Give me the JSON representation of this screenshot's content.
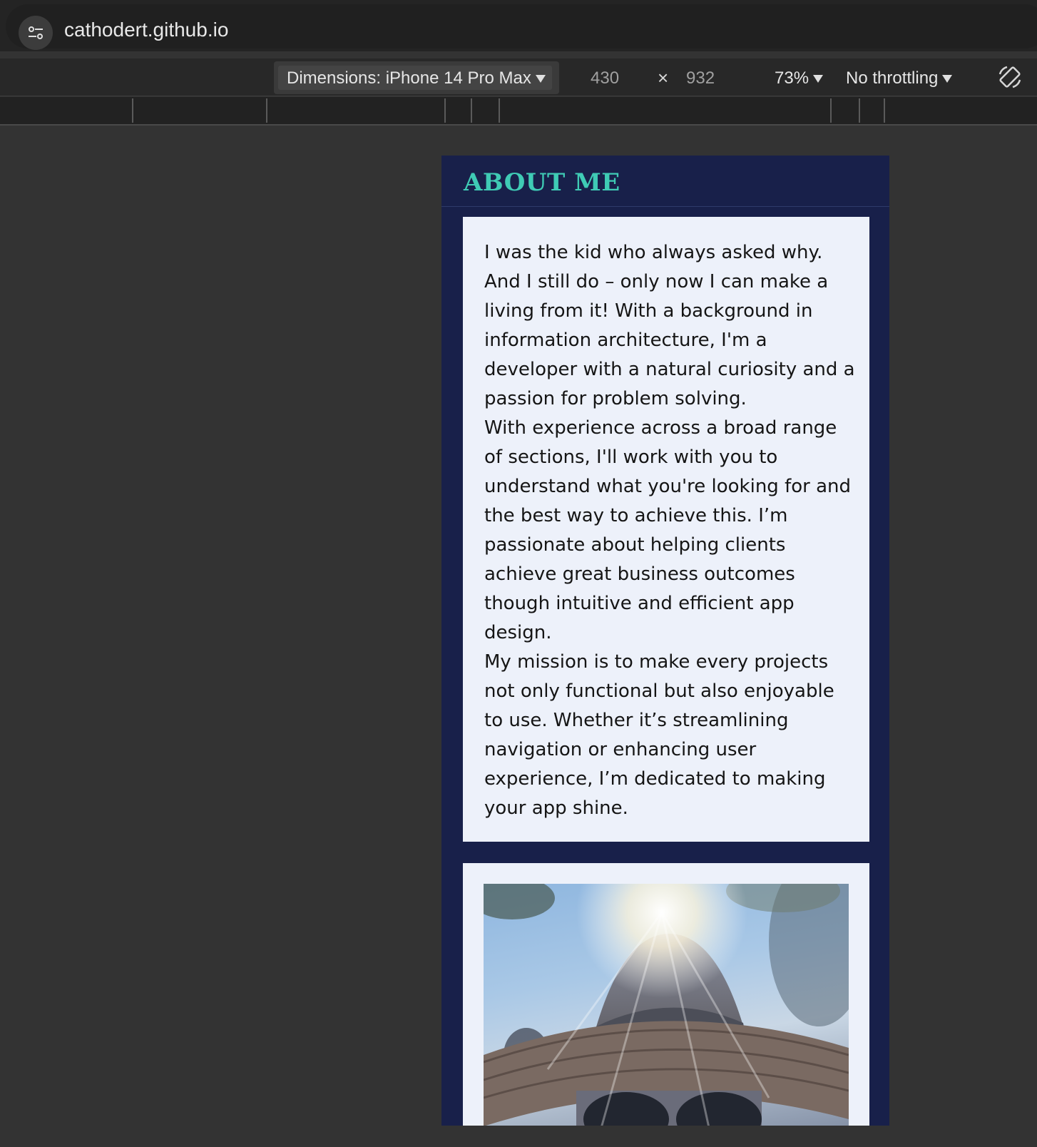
{
  "browser": {
    "url": "cathodert.github.io",
    "site_info_icon": "tune-icon"
  },
  "device_toolbar": {
    "dimensions_label": "Dimensions: iPhone 14 Pro Max",
    "width": "430",
    "separator": "×",
    "height": "932",
    "zoom": "73%",
    "throttling": "No throttling",
    "rotate_icon": "rotate-icon"
  },
  "page": {
    "section_title": "ABOUT ME",
    "paragraphs": [
      "I was the kid who always asked why. And I still do – only now I can make a living from it! With a background in information architecture, I'm a developer with a natural curiosity and a passion for problem solving.",
      "With experience across a broad range of sections, I'll work with you to understand what you're looking for and the best way to achieve this. I’m passionate about helping clients achieve great business outcomes though intuitive and efficient app design.",
      "My mission is to make every projects not only functional but also enjoyable to use. Whether it’s streamlining navigation or enhancing user experience, I’m dedicated to making your app shine."
    ]
  },
  "colors": {
    "page_bg": "#18204a",
    "accent": "#3fcbb5",
    "card_bg": "#edf1fa",
    "devtools_bg": "#333333"
  }
}
